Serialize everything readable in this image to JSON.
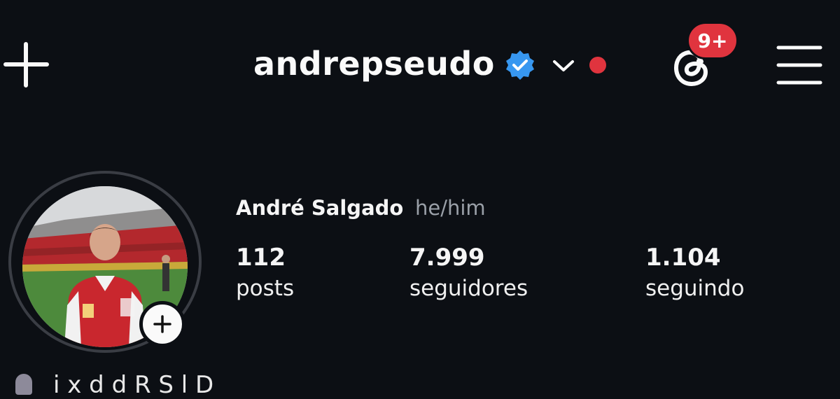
{
  "header": {
    "username": "andrepseudo",
    "notification_badge": "9+",
    "icons": {
      "new": "plus-icon",
      "verified": "verified-badge-icon",
      "switch": "chevron-down-icon",
      "threads": "threads-icon",
      "menu": "hamburger-menu-icon"
    }
  },
  "profile": {
    "full_name": "André Salgado",
    "pronouns": "he/him",
    "stats": [
      {
        "value": "112",
        "label": "posts"
      },
      {
        "value": "7.999",
        "label": "seguidores"
      },
      {
        "value": "1.104",
        "label": "seguindo"
      }
    ],
    "bio_peek": "i    x   d  d  R  S  l    D"
  },
  "colors": {
    "background": "#0c0f14",
    "accent_red": "#e0343e",
    "verified_blue": "#3797f0",
    "muted_text": "#9aa0a8"
  }
}
